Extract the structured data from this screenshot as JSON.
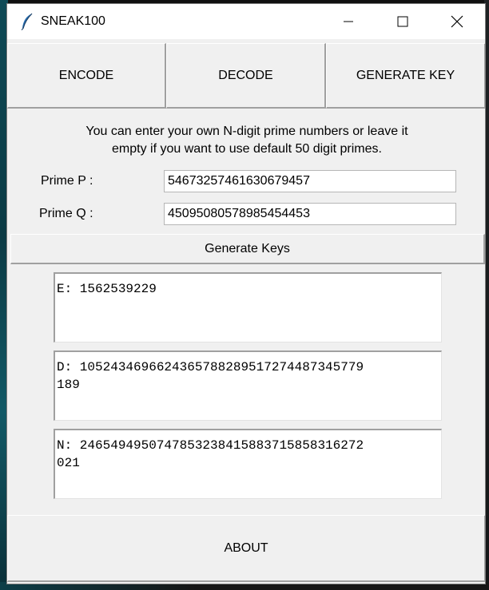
{
  "window": {
    "title": "SNEAK100"
  },
  "tabs": {
    "encode": "ENCODE",
    "decode": "DECODE",
    "generate_key": "GENERATE KEY"
  },
  "info": {
    "line1": "You can enter your own N-digit prime numbers or leave it",
    "line2": "empty if you want to use default 50 digit primes."
  },
  "fields": {
    "prime_p_label": "Prime P :",
    "prime_p_value": "54673257461630679457",
    "prime_q_label": "Prime Q :",
    "prime_q_value": "45095080578985454453"
  },
  "generate_button": "Generate Keys",
  "keys": {
    "e": "E: 1562539229",
    "d": "D: 1052434696624365788289517274487345779\n189",
    "n": "N: 2465494950747853238415883715858316272\n021"
  },
  "about_button": "ABOUT",
  "colors": {
    "window_bg": "#f0f0f0",
    "titlebar_bg": "#ffffff",
    "text": "#000000"
  }
}
